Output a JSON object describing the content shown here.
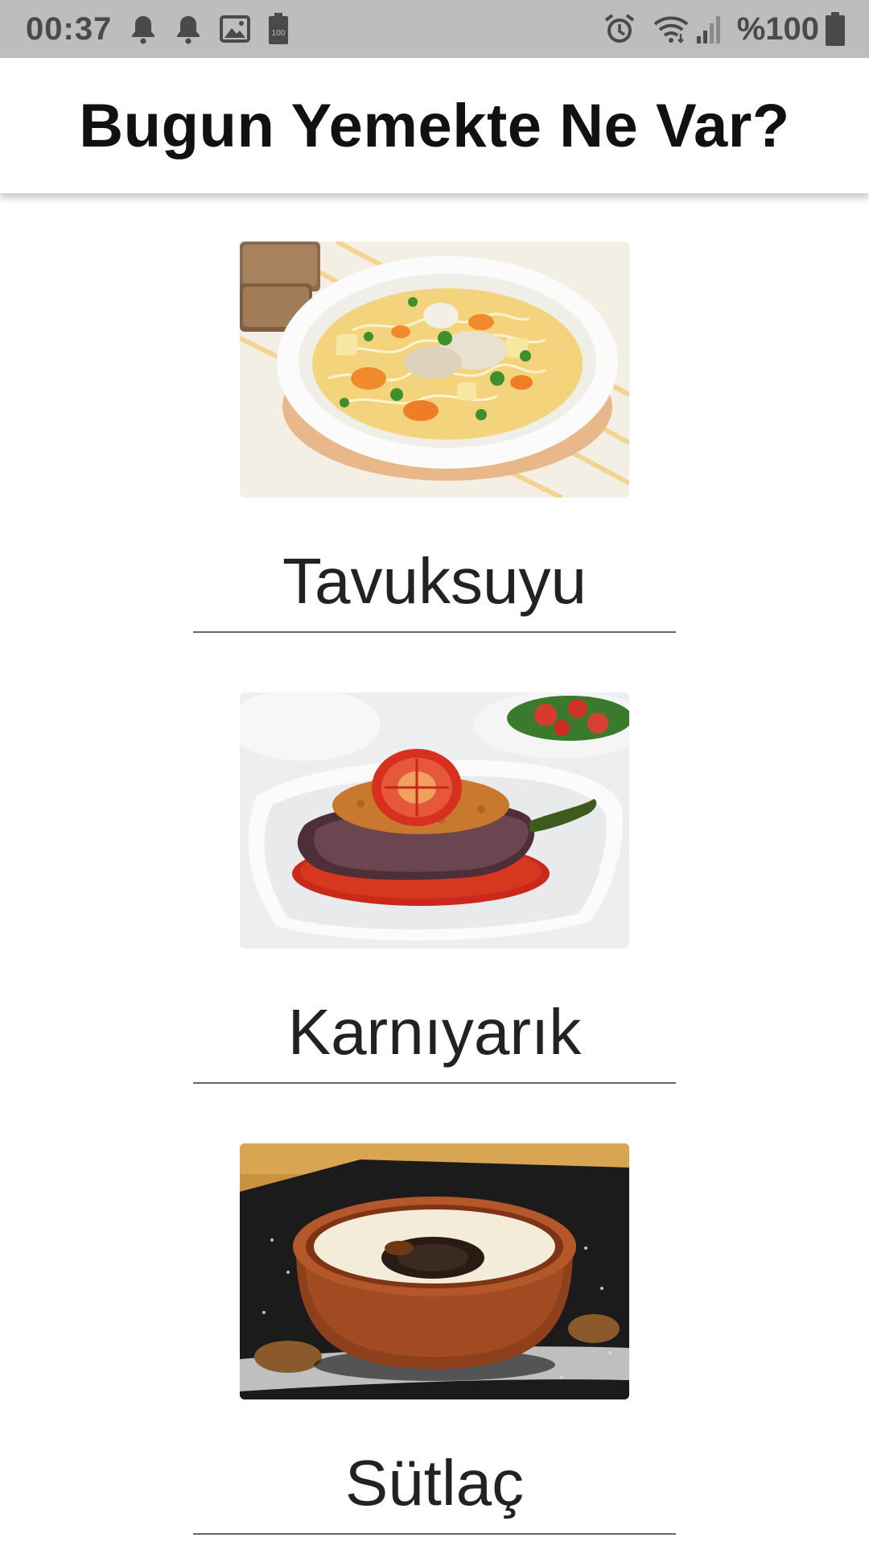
{
  "status_bar": {
    "time": "00:37",
    "battery_text": "%100",
    "battery_chip": "100",
    "icons": [
      "bell-icon",
      "bell-icon",
      "image-icon",
      "battery-saver-icon",
      "alarm-icon",
      "wifi-icon",
      "signal-icon",
      "battery-icon"
    ]
  },
  "app_bar": {
    "title": "Bugun Yemekte Ne Var?"
  },
  "foods": [
    {
      "name": "Tavuksuyu",
      "image": "chicken-soup-photo"
    },
    {
      "name": "Karnıyarık",
      "image": "stuffed-eggplant-photo"
    },
    {
      "name": "Sütlaç",
      "image": "rice-pudding-photo"
    }
  ],
  "colors": {
    "status_bar_bg": "#bdbdbd",
    "app_bar_bg": "#ffffff",
    "underline": "#666666"
  }
}
